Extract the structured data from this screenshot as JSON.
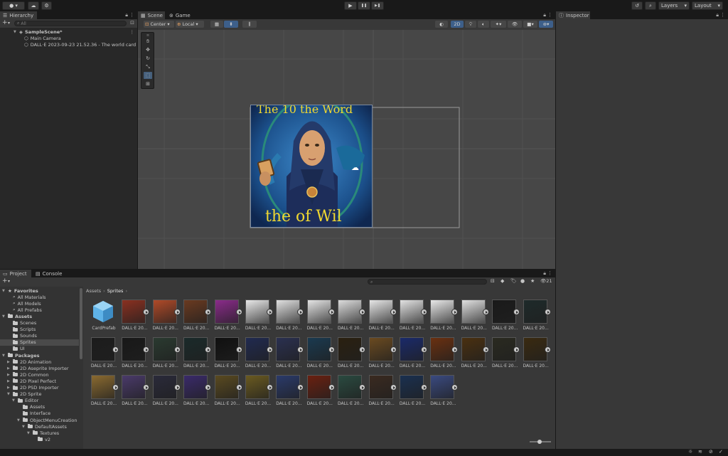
{
  "toolbar": {
    "account_icon": "account-icon",
    "cloud_icon": "cloud-icon",
    "settings_icon": "gear-icon",
    "play": "▶",
    "pause": "❚❚",
    "step": "▶❚",
    "layers_label": "Layers",
    "layout_label": "Layout"
  },
  "hierarchy": {
    "tab": "Hierarchy",
    "search_placeholder": "All",
    "scene_name": "SampleScene*",
    "items": [
      "Main Camera",
      "DALL·E 2023-09-23 21.52.36 - The world card"
    ]
  },
  "scene": {
    "tabs": [
      "Scene",
      "Game"
    ],
    "pivot_label": "Center",
    "space_label": "Local",
    "mode_2d": "2D",
    "sprite_texts": [
      "The 10 the Word",
      "the of Wil"
    ]
  },
  "inspector": {
    "tab": "Inspector"
  },
  "project": {
    "tabs": [
      "Project",
      "Console"
    ],
    "breadcrumb": [
      "Assets",
      "Sprites"
    ],
    "hidden_count": "21",
    "tree": [
      {
        "label": "Favorites",
        "level": 0,
        "kind": "star",
        "bold": true
      },
      {
        "label": "All Materials",
        "level": 1,
        "kind": "search"
      },
      {
        "label": "All Models",
        "level": 1,
        "kind": "search"
      },
      {
        "label": "All Prefabs",
        "level": 1,
        "kind": "search"
      },
      {
        "label": "Assets",
        "level": 0,
        "kind": "folder",
        "bold": true
      },
      {
        "label": "Scenes",
        "level": 1,
        "kind": "folder"
      },
      {
        "label": "Scripts",
        "level": 1,
        "kind": "folder"
      },
      {
        "label": "Sounds",
        "level": 1,
        "kind": "folder"
      },
      {
        "label": "Sprites",
        "level": 1,
        "kind": "folder",
        "selected": true
      },
      {
        "label": "UI",
        "level": 1,
        "kind": "folder"
      },
      {
        "label": "Packages",
        "level": 0,
        "kind": "folder",
        "bold": true
      },
      {
        "label": "2D Animation",
        "level": 1,
        "kind": "folder",
        "arrow": true
      },
      {
        "label": "2D Aseprite Importer",
        "level": 1,
        "kind": "folder",
        "arrow": true
      },
      {
        "label": "2D Common",
        "level": 1,
        "kind": "folder",
        "arrow": true
      },
      {
        "label": "2D Pixel Perfect",
        "level": 1,
        "kind": "folder",
        "arrow": true
      },
      {
        "label": "2D PSD Importer",
        "level": 1,
        "kind": "folder",
        "arrow": true
      },
      {
        "label": "2D Sprite",
        "level": 1,
        "kind": "folder",
        "open": true
      },
      {
        "label": "Editor",
        "level": 2,
        "kind": "folder",
        "open": true
      },
      {
        "label": "Assets",
        "level": 3,
        "kind": "folder"
      },
      {
        "label": "Interface",
        "level": 3,
        "kind": "folder"
      },
      {
        "label": "ObjectMenuCreation",
        "level": 3,
        "kind": "folder",
        "open": true
      },
      {
        "label": "DefaultAssets",
        "level": 4,
        "kind": "folder",
        "open": true
      },
      {
        "label": "Textures",
        "level": 5,
        "kind": "folder",
        "open": true
      },
      {
        "label": "v2",
        "level": 6,
        "kind": "folder"
      }
    ],
    "prefab_label": "CardPrefab",
    "asset_label": "DALL·E 20...",
    "asset_colors": [
      "#8a3020",
      "#b04a28",
      "#6a3a20",
      "#8a2b8a",
      "#e8e8e8",
      "#e0e0e0",
      "#e4e4e4",
      "#dcdcdc",
      "#e6e6e6",
      "#e2e2e2",
      "#e8e8e8",
      "#e0e0e0",
      "#1a1a1a",
      "#1e2a2a",
      "#1c1c1c",
      "#181818",
      "#2a3a30",
      "#1a2a2a",
      "#101010",
      "#202a50",
      "#2a3050",
      "#1a3a50",
      "#2a2010",
      "#6a4a20",
      "#1a2a6a",
      "#6a3010",
      "#4a3010",
      "#2a2a20",
      "#3a2a10",
      "#8a6a30",
      "#4a3a6a",
      "#2a2a3a",
      "#3a2a6a",
      "#5a4a20",
      "#6a5a20",
      "#2a3a6a",
      "#6a2010",
      "#2a4a40",
      "#3a2a20",
      "#1a3050",
      "#3a4a80"
    ]
  }
}
